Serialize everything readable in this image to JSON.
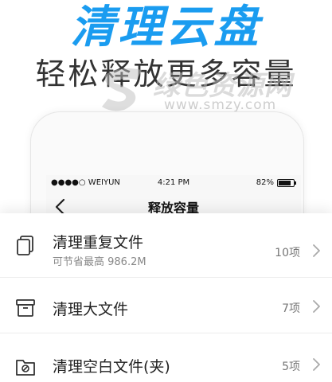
{
  "promo": {
    "headline": "清理云盘",
    "subheadline": "轻松释放更多容量"
  },
  "watermark": {
    "text": "绿色资源网",
    "url": "www.smzy.com"
  },
  "status_bar": {
    "carrier": "●●●●○ WEIYUN",
    "time": "4:21 PM",
    "battery": "82%"
  },
  "nav": {
    "title": "释放容量",
    "back_icon": "chevron-left-icon"
  },
  "items": [
    {
      "title": "清理重复文件",
      "subtitle": "可节省最高 986.2M",
      "count": "10项",
      "icon": "duplicate-files-icon"
    },
    {
      "title": "清理大文件",
      "subtitle": "",
      "count": "7项",
      "icon": "archive-box-icon"
    },
    {
      "title": "清理空白文件(夹)",
      "subtitle": "",
      "count": "5项",
      "icon": "empty-folder-icon"
    }
  ],
  "colors": {
    "accent": "#1a9cf0",
    "text": "#222222",
    "muted": "#888888"
  }
}
